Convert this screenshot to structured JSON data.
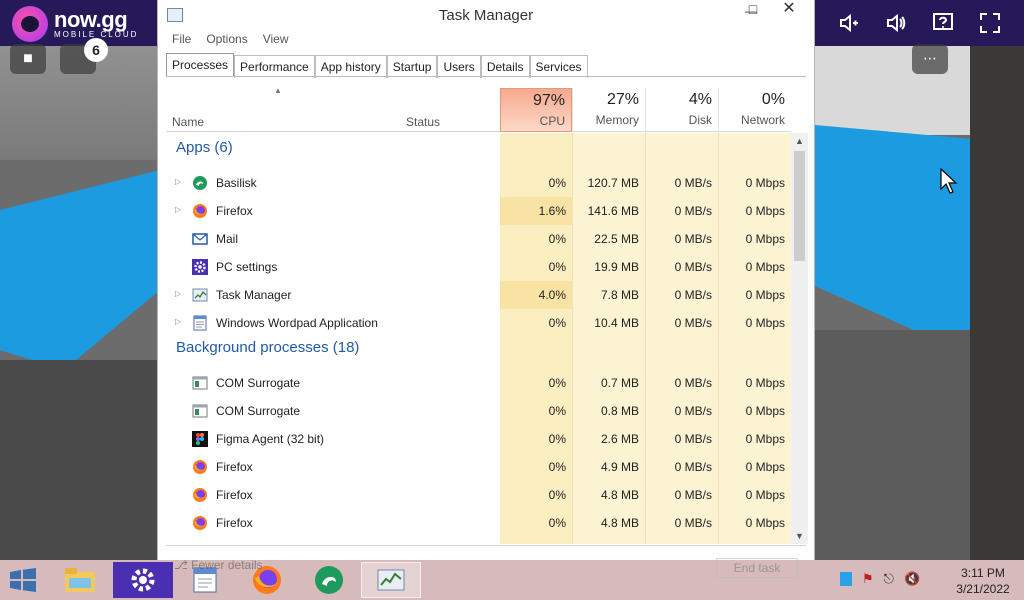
{
  "nowgg": {
    "brand": "now.gg",
    "sub": "MOBILE CLOUD",
    "notification_count": "6"
  },
  "window": {
    "title": "Task Manager",
    "menu": [
      "File",
      "Options",
      "View"
    ],
    "tabs": [
      "Processes",
      "Performance",
      "App history",
      "Startup",
      "Users",
      "Details",
      "Services"
    ],
    "active_tab": "Processes"
  },
  "columns": {
    "name": "Name",
    "status": "Status",
    "cpu": {
      "pct": "97%",
      "label": "CPU"
    },
    "memory": {
      "pct": "27%",
      "label": "Memory"
    },
    "disk": {
      "pct": "4%",
      "label": "Disk"
    },
    "network": {
      "pct": "0%",
      "label": "Network"
    }
  },
  "groups": [
    {
      "title": "Apps (6)",
      "rows": [
        {
          "name": "Basilisk",
          "icon": "basilisk-icon",
          "expand": true,
          "cpu": "0%",
          "mem": "120.7 MB",
          "disk": "0 MB/s",
          "net": "0 Mbps"
        },
        {
          "name": "Firefox",
          "icon": "firefox-icon",
          "expand": true,
          "cpu": "1.6%",
          "mem": "141.6 MB",
          "disk": "0 MB/s",
          "net": "0 Mbps"
        },
        {
          "name": "Mail",
          "icon": "mail-icon",
          "expand": false,
          "cpu": "0%",
          "mem": "22.5 MB",
          "disk": "0 MB/s",
          "net": "0 Mbps"
        },
        {
          "name": "PC settings",
          "icon": "gear-icon",
          "expand": false,
          "cpu": "0%",
          "mem": "19.9 MB",
          "disk": "0 MB/s",
          "net": "0 Mbps"
        },
        {
          "name": "Task Manager",
          "icon": "task-manager-icon",
          "expand": true,
          "cpu": "4.0%",
          "mem": "7.8 MB",
          "disk": "0 MB/s",
          "net": "0 Mbps"
        },
        {
          "name": "Windows Wordpad Application",
          "icon": "wordpad-icon",
          "expand": true,
          "cpu": "0%",
          "mem": "10.4 MB",
          "disk": "0 MB/s",
          "net": "0 Mbps"
        }
      ]
    },
    {
      "title": "Background processes (18)",
      "rows": [
        {
          "name": "COM Surrogate",
          "icon": "com-surrogate-icon",
          "expand": false,
          "cpu": "0%",
          "mem": "0.7 MB",
          "disk": "0 MB/s",
          "net": "0 Mbps"
        },
        {
          "name": "COM Surrogate",
          "icon": "com-surrogate-icon",
          "expand": false,
          "cpu": "0%",
          "mem": "0.8 MB",
          "disk": "0 MB/s",
          "net": "0 Mbps"
        },
        {
          "name": "Figma Agent (32 bit)",
          "icon": "figma-icon",
          "expand": false,
          "cpu": "0%",
          "mem": "2.6 MB",
          "disk": "0 MB/s",
          "net": "0 Mbps"
        },
        {
          "name": "Firefox",
          "icon": "firefox-icon",
          "expand": false,
          "cpu": "0%",
          "mem": "4.9 MB",
          "disk": "0 MB/s",
          "net": "0 Mbps"
        },
        {
          "name": "Firefox",
          "icon": "firefox-icon",
          "expand": false,
          "cpu": "0%",
          "mem": "4.8 MB",
          "disk": "0 MB/s",
          "net": "0 Mbps"
        },
        {
          "name": "Firefox",
          "icon": "firefox-icon",
          "expand": false,
          "cpu": "0%",
          "mem": "4.8 MB",
          "disk": "0 MB/s",
          "net": "0 Mbps"
        }
      ]
    }
  ],
  "footer": {
    "fewer_details": "Fewer details",
    "end_task": "End task"
  },
  "taskbar": {
    "apps": [
      "file-explorer-icon",
      "pc-settings-icon",
      "wordpad-icon",
      "firefox-icon",
      "basilisk-icon",
      "task-manager-icon"
    ],
    "time": "3:11 PM",
    "date": "3/21/2022"
  },
  "colors": {
    "accent_blue": "#1f5aa8",
    "cpu_header": "#f6a98d",
    "metric_stripe": "#fcf3d3",
    "nowgg_bar": "#25195a"
  }
}
